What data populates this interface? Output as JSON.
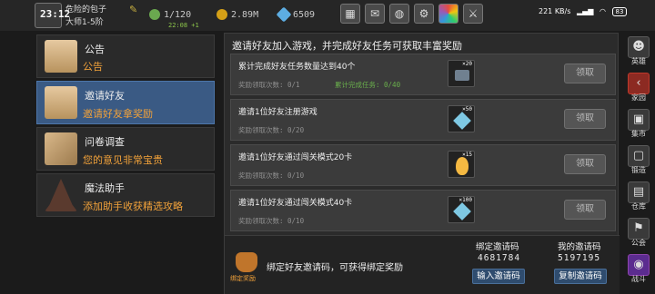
{
  "topbar": {
    "time": "23:12",
    "player_name": "危险的包子",
    "player_rank": "大师1-5阶",
    "stamina": "1/120",
    "stamina_timer": "22:08 +1",
    "gold": "2.89M",
    "gems": "6509",
    "buttons": [
      "shop-icon",
      "mail-icon",
      "gamepad-icon",
      "gear-icon",
      "color-wheel-icon",
      "sword-icon"
    ],
    "status": {
      "net_speed": "221 KB/s",
      "battery": "83"
    }
  },
  "left_tabs": [
    {
      "title": "公告",
      "subtitle": "公告",
      "icon": "envelope-icon",
      "active": false
    },
    {
      "title": "邀请好友",
      "subtitle": "邀请好友拿奖励",
      "icon": "envelope-icon",
      "active": true
    },
    {
      "title": "问卷调查",
      "subtitle": "您的意见非常宝贵",
      "icon": "scroll-icon",
      "active": false
    },
    {
      "title": "魔法助手",
      "subtitle": "添加助手收获精选攻略",
      "icon": "wizard-hat-icon",
      "active": false
    }
  ],
  "main": {
    "header": "邀请好友加入游戏，并完成好友任务可获取丰富奖励",
    "tasks": [
      {
        "title": "累计完成好友任务数量达到40个",
        "progress": "奖励领取次数: 0/1",
        "extra": "累计完成任务: 0/40",
        "reward_count": "×20",
        "reward_icon": "anvil-icon",
        "button": "领取"
      },
      {
        "title": "邀请1位好友注册游戏",
        "progress": "奖励领取次数: 0/20",
        "extra": "",
        "reward_count": "×50",
        "reward_icon": "diamond-icon",
        "button": "领取"
      },
      {
        "title": "邀请1位好友通过闯关模式20卡",
        "progress": "奖励领取次数: 0/10",
        "extra": "",
        "reward_count": "×15",
        "reward_icon": "gold-egg-icon",
        "button": "领取"
      },
      {
        "title": "邀请1位好友通过闯关模式40卡",
        "progress": "奖励领取次数: 0/10",
        "extra": "",
        "reward_count": "×100",
        "reward_icon": "diamond-icon",
        "button": "领取"
      }
    ],
    "bind": {
      "icon_label": "绑定奖励",
      "text": "绑定好友邀请码，可获得绑定奖励",
      "bind_code_label": "绑定邀请码",
      "bind_code": "4681784",
      "input_button": "输入邀请码",
      "my_code_label": "我的邀请码",
      "my_code": "5197195",
      "copy_button": "复制邀请码"
    }
  },
  "right_nav": [
    {
      "label": "英雄",
      "icon": "hero-icon",
      "glyph": "☻"
    },
    {
      "label": "家园",
      "icon": "home-icon",
      "glyph": "‹",
      "active": true
    },
    {
      "label": "集市",
      "icon": "market-icon",
      "glyph": "▣"
    },
    {
      "label": "锻造",
      "icon": "anvil-icon",
      "glyph": "▢"
    },
    {
      "label": "仓库",
      "icon": "warehouse-icon",
      "glyph": "▤"
    },
    {
      "label": "公会",
      "icon": "guild-icon",
      "glyph": "⚑"
    },
    {
      "label": "战斗",
      "icon": "battle-icon",
      "glyph": "◉"
    }
  ]
}
